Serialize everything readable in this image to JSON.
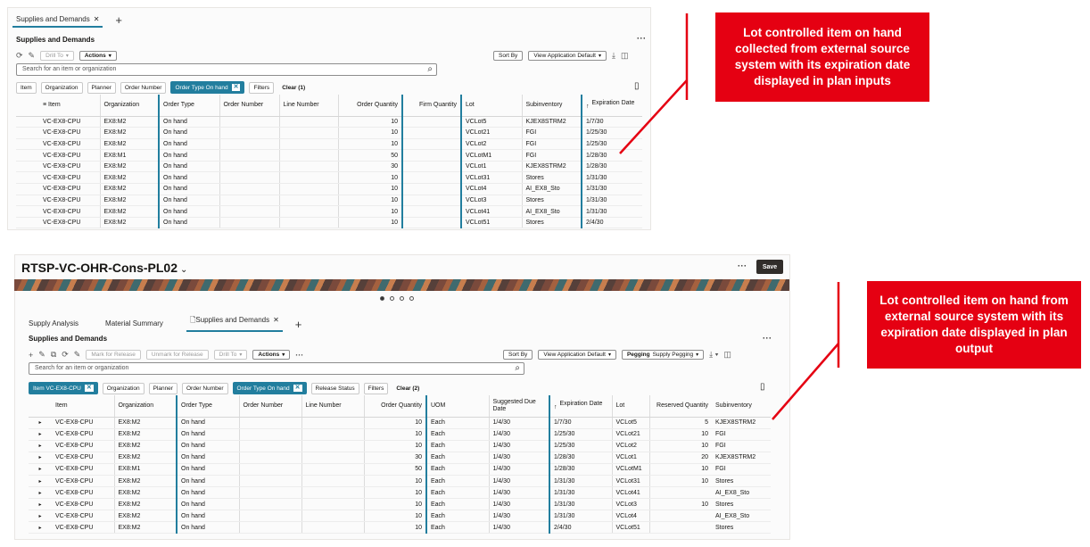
{
  "top": {
    "tab_label": "Supplies and Demands",
    "section_title": "Supplies and Demands",
    "drill_to": "Drill To",
    "actions": "Actions",
    "sort_by": "Sort By",
    "view": "View Application Default",
    "search_placeholder": "Search for an item or organization",
    "chips": [
      "Item",
      "Organization",
      "Planner",
      "Order Number"
    ],
    "active_chip": "Order Type On hand",
    "filters": "Filters",
    "clear": "Clear (1)",
    "columns": [
      "Item",
      "Organization",
      "Order Type",
      "Order Number",
      "Line Number",
      "Order Quantity",
      "Firm Quantity",
      "Lot",
      "Subinventory",
      "Expiration Date"
    ],
    "rows": [
      [
        "VC-EX8-CPU",
        "EX8:M2",
        "On hand",
        "",
        "",
        "10",
        "",
        "VCLot5",
        "KJEX8STRM2",
        "1/7/30"
      ],
      [
        "VC-EX8-CPU",
        "EX8:M2",
        "On hand",
        "",
        "",
        "10",
        "",
        "VCLot21",
        "FGI",
        "1/25/30"
      ],
      [
        "VC-EX8-CPU",
        "EX8:M2",
        "On hand",
        "",
        "",
        "10",
        "",
        "VCLot2",
        "FGI",
        "1/25/30"
      ],
      [
        "VC-EX8-CPU",
        "EX8:M1",
        "On hand",
        "",
        "",
        "50",
        "",
        "VCLotM1",
        "FGI",
        "1/28/30"
      ],
      [
        "VC-EX8-CPU",
        "EX8:M2",
        "On hand",
        "",
        "",
        "30",
        "",
        "VCLot1",
        "KJEX8STRM2",
        "1/28/30"
      ],
      [
        "VC-EX8-CPU",
        "EX8:M2",
        "On hand",
        "",
        "",
        "10",
        "",
        "VCLot31",
        "Stores",
        "1/31/30"
      ],
      [
        "VC-EX8-CPU",
        "EX8:M2",
        "On hand",
        "",
        "",
        "10",
        "",
        "VCLot4",
        "AI_EX8_Sto",
        "1/31/30"
      ],
      [
        "VC-EX8-CPU",
        "EX8:M2",
        "On hand",
        "",
        "",
        "10",
        "",
        "VCLot3",
        "Stores",
        "1/31/30"
      ],
      [
        "VC-EX8-CPU",
        "EX8:M2",
        "On hand",
        "",
        "",
        "10",
        "",
        "VCLot41",
        "AI_EX8_Sto",
        "1/31/30"
      ],
      [
        "VC-EX8-CPU",
        "EX8:M2",
        "On hand",
        "",
        "",
        "10",
        "",
        "VCLot51",
        "Stores",
        "2/4/30"
      ]
    ]
  },
  "bottom": {
    "plan_name": "RTSP-VC-OHR-Cons-PL02",
    "save": "Save",
    "tabs": [
      "Supply Analysis",
      "Material Summary",
      "Supplies and Demands"
    ],
    "section_title": "Supplies and Demands",
    "mark_release": "Mark for Release",
    "unmark_release": "Unmark for Release",
    "drill_to": "Drill To",
    "actions": "Actions",
    "sort_by": "Sort By",
    "view": "View Application Default",
    "pegging_label": "Pegging",
    "pegging_value": "Supply Pegging",
    "search_placeholder": "Search for an item or organization",
    "item_chip": "Item VC-EX8-CPU",
    "chips": [
      "Organization",
      "Planner",
      "Order Number"
    ],
    "active_chip": "Order Type On hand",
    "release_status": "Release Status",
    "filters": "Filters",
    "clear": "Clear (2)",
    "columns": [
      "Item",
      "Organization",
      "Order Type",
      "Order Number",
      "Line Number",
      "Order Quantity",
      "UOM",
      "Suggested Due Date",
      "Expiration Date",
      "Lot",
      "Reserved Quantity",
      "Subinventory"
    ],
    "rows": [
      [
        "VC-EX8-CPU",
        "EX8:M2",
        "On hand",
        "",
        "",
        "10",
        "Each",
        "1/4/30",
        "1/7/30",
        "VCLot5",
        "5",
        "KJEX8STRM2"
      ],
      [
        "VC-EX8-CPU",
        "EX8:M2",
        "On hand",
        "",
        "",
        "10",
        "Each",
        "1/4/30",
        "1/25/30",
        "VCLot21",
        "10",
        "FGI"
      ],
      [
        "VC-EX8-CPU",
        "EX8:M2",
        "On hand",
        "",
        "",
        "10",
        "Each",
        "1/4/30",
        "1/25/30",
        "VCLot2",
        "10",
        "FGI"
      ],
      [
        "VC-EX8-CPU",
        "EX8:M2",
        "On hand",
        "",
        "",
        "30",
        "Each",
        "1/4/30",
        "1/28/30",
        "VCLot1",
        "20",
        "KJEX8STRM2"
      ],
      [
        "VC-EX8-CPU",
        "EX8:M1",
        "On hand",
        "",
        "",
        "50",
        "Each",
        "1/4/30",
        "1/28/30",
        "VCLotM1",
        "10",
        "FGI"
      ],
      [
        "VC-EX8-CPU",
        "EX8:M2",
        "On hand",
        "",
        "",
        "10",
        "Each",
        "1/4/30",
        "1/31/30",
        "VCLot31",
        "10",
        "Stores"
      ],
      [
        "VC-EX8-CPU",
        "EX8:M2",
        "On hand",
        "",
        "",
        "10",
        "Each",
        "1/4/30",
        "1/31/30",
        "VCLot41",
        "",
        "AI_EX8_Sto"
      ],
      [
        "VC-EX8-CPU",
        "EX8:M2",
        "On hand",
        "",
        "",
        "10",
        "Each",
        "1/4/30",
        "1/31/30",
        "VCLot3",
        "10",
        "Stores"
      ],
      [
        "VC-EX8-CPU",
        "EX8:M2",
        "On hand",
        "",
        "",
        "10",
        "Each",
        "1/4/30",
        "1/31/30",
        "VCLot4",
        "",
        "AI_EX8_Sto"
      ],
      [
        "VC-EX8-CPU",
        "EX8:M2",
        "On hand",
        "",
        "",
        "10",
        "Each",
        "1/4/30",
        "2/4/30",
        "VCLot51",
        "",
        "Stores"
      ]
    ]
  },
  "callouts": {
    "input": "Lot controlled item on hand collected from external source system with its expiration date displayed in plan inputs",
    "output": "Lot controlled item on hand from external source system with its expiration date displayed in plan output"
  },
  "colors": {
    "accent": "#227e9e",
    "callout": "#e50012",
    "save_bg": "#312d2a"
  }
}
